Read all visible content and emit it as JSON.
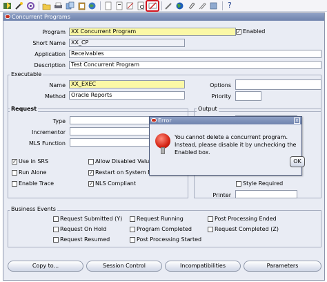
{
  "toolbar": {
    "icons": [
      "save-icon",
      "wand-icon",
      "refresh-icon",
      "folder-icon",
      "print-icon",
      "copy-icon",
      "paste-icon",
      "new-icon",
      "new-alt-icon",
      "clear-icon",
      "delete-record-icon",
      "edit-icon",
      "attach-icon",
      "world-icon",
      "clip-icon",
      "tools-icon",
      "help-icon"
    ],
    "help_label": "?"
  },
  "window": {
    "title": "Concurrent Programs"
  },
  "form": {
    "program_label": "Program",
    "program_value": "XX Concurrent Program",
    "enabled_label": "Enabled",
    "enabled_checked": true,
    "short_name_label": "Short Name",
    "short_name_value": "XX_CP",
    "application_label": "Application",
    "application_value": "Receivables",
    "description_label": "Description",
    "description_value": "Test Concurrent Program"
  },
  "executable": {
    "section_title": "Executable",
    "name_label": "Name",
    "name_value": "XX_EXEC",
    "method_label": "Method",
    "method_value": "Oracle Reports",
    "options_label": "Options",
    "options_value": "",
    "priority_label": "Priority",
    "priority_value": ""
  },
  "request": {
    "section_title": "Request",
    "type_label": "Type",
    "incrementor_label": "Incrementor",
    "mls_label": "MLS Function",
    "checks": [
      {
        "label": "Use in SRS",
        "checked": true
      },
      {
        "label": "Allow Disabled Values",
        "checked": false
      },
      {
        "label": "Run Alone",
        "checked": false
      },
      {
        "label": "Restart on System Fa",
        "checked": true
      },
      {
        "label": "Enable Trace",
        "checked": false
      },
      {
        "label": "NLS Compliant",
        "checked": true
      }
    ]
  },
  "output": {
    "section_title": "Output",
    "style_required_label": "Style Required",
    "printer_label": "Printer"
  },
  "business_events": {
    "section_title": "Business Events",
    "items": [
      {
        "label": "Request Submitted (Y)"
      },
      {
        "label": "Request Running"
      },
      {
        "label": "Post Processing Ended"
      },
      {
        "label": "Request On Hold"
      },
      {
        "label": "Program Completed"
      },
      {
        "label": "Request Completed (Z)"
      },
      {
        "label": "Request Resumed"
      },
      {
        "label": "Post Processing Started"
      }
    ]
  },
  "buttons": {
    "copy_to": "Copy to...",
    "session_control": "Session Control",
    "incompatibilities": "Incompatibilities",
    "parameters": "Parameters"
  },
  "dialog": {
    "title": "Error",
    "message": "You cannot delete a concurrent program. Instead, please disable it by unchecking the Enabled box.",
    "ok_label": "OK",
    "close_label": "x"
  }
}
